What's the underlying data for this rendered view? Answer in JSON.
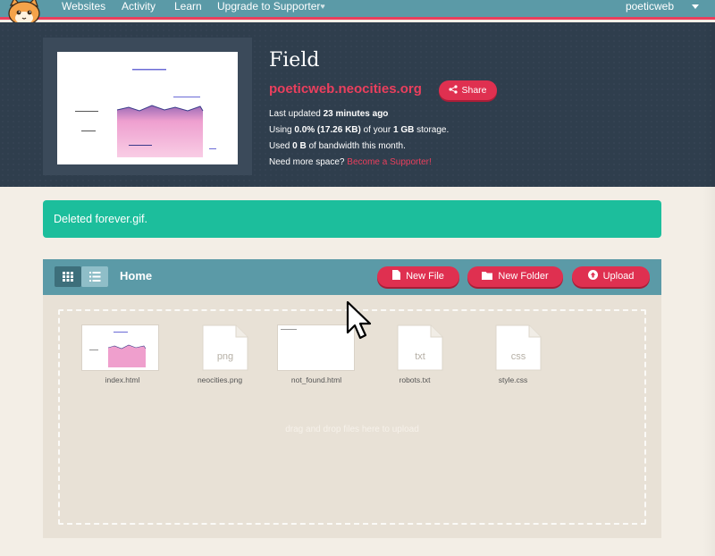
{
  "nav": {
    "links": [
      "Websites",
      "Activity",
      "Learn",
      "Upgrade to Supporter"
    ],
    "user": "poeticweb"
  },
  "site": {
    "title": "Field",
    "domain": "poeticweb.neocities.org",
    "share_label": "Share",
    "updated_prefix": "Last updated ",
    "updated_value": "23 minutes ago",
    "using_prefix": "Using ",
    "using_value": "0.0% (17.26 KB)",
    "using_mid": " of your ",
    "using_quota": "1 GB",
    "using_suffix": " storage.",
    "used_prefix": "Used ",
    "used_value": "0 B",
    "used_suffix": " of bandwidth this month.",
    "more_space_prefix": "Need more space? ",
    "more_space_link": "Become a Supporter!"
  },
  "alert": {
    "message": "Deleted forever.gif."
  },
  "files": {
    "home_label": "Home",
    "new_file_label": "New File",
    "new_folder_label": "New Folder",
    "upload_label": "Upload",
    "drop_text": "drag and drop files here to upload",
    "items": [
      {
        "name": "index.html",
        "ext": ""
      },
      {
        "name": "neocities.png",
        "ext": "png"
      },
      {
        "name": "not_found.html",
        "ext": ""
      },
      {
        "name": "robots.txt",
        "ext": "txt"
      },
      {
        "name": "style.css",
        "ext": "css"
      }
    ]
  },
  "colors": {
    "nav_bg": "#5b9aa7",
    "accent": "#ea3f5d",
    "header_bg": "#2f3e4d",
    "alert_bg": "#1cbe9c",
    "page_bg": "#f3eee6"
  }
}
